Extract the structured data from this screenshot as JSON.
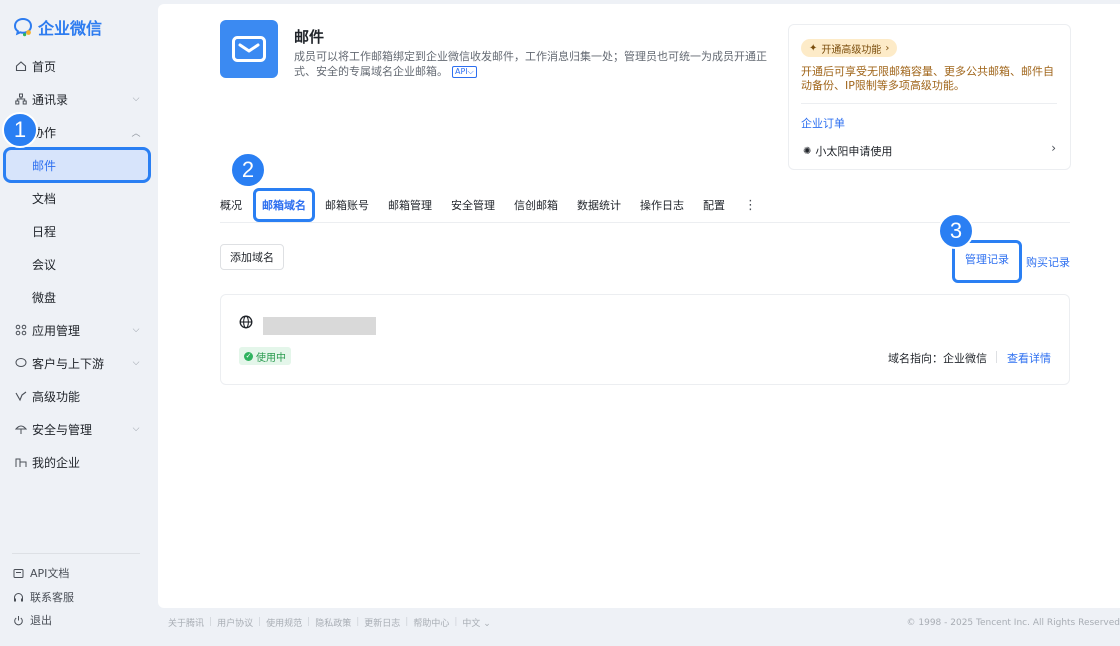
{
  "brand": {
    "name": "企业微信",
    "color": "#2d7cf0"
  },
  "sidebar": {
    "items": [
      {
        "label": "首页",
        "icon": "home-icon"
      },
      {
        "label": "通讯录",
        "icon": "org-tree-icon",
        "expandable": true
      },
      {
        "label": "协作",
        "icon": "collab-icon",
        "expandable": true,
        "expanded": true
      },
      {
        "label": "邮件",
        "sub": true,
        "active": true
      },
      {
        "label": "文档",
        "sub": true
      },
      {
        "label": "日程",
        "sub": true
      },
      {
        "label": "会议",
        "sub": true
      },
      {
        "label": "微盘",
        "sub": true
      },
      {
        "label": "应用管理",
        "icon": "grid-icon",
        "expandable": true
      },
      {
        "label": "客户与上下游",
        "icon": "chat-bubble-icon",
        "expandable": true
      },
      {
        "label": "高级功能",
        "icon": "sparkle-icon"
      },
      {
        "label": "安全与管理",
        "icon": "umbrella-icon",
        "expandable": true
      },
      {
        "label": "我的企业",
        "icon": "building-icon"
      }
    ],
    "bottom": [
      {
        "label": "API文档",
        "icon": "api-doc-icon"
      },
      {
        "label": "联系客服",
        "icon": "headset-icon"
      },
      {
        "label": "退出",
        "icon": "power-icon"
      }
    ]
  },
  "steps": [
    "1",
    "2",
    "3"
  ],
  "app": {
    "title": "邮件",
    "description": "成员可以将工作邮箱绑定到企业微信收发邮件，工作消息归集一处；管理员也可统一为成员开通正式、安全的专属域名企业邮箱。",
    "api_chip": "API"
  },
  "promo": {
    "badge": "开通高级功能",
    "text": "开通后可享受无限邮箱容量、更多公共邮箱、邮件自动备份、IP限制等多项高级功能。",
    "order_title": "企业订单",
    "sun_label": "小太阳申请使用"
  },
  "tabs": [
    "概况",
    "邮箱域名",
    "邮箱账号",
    "邮箱管理",
    "安全管理",
    "信创邮箱",
    "数据统计",
    "操作日志",
    "配置"
  ],
  "active_tab": "邮箱域名",
  "toolbar": {
    "add_domain": "添加域名",
    "manage_records": "管理记录",
    "buy_records": "购买记录"
  },
  "domain": {
    "status": "使用中",
    "pointing": "域名指向：企业微信",
    "detail": "查看详情"
  },
  "footer": {
    "links": [
      "关于腾讯",
      "用户协议",
      "使用规范",
      "隐私政策",
      "更新日志",
      "帮助中心",
      "中文"
    ],
    "copyright": "© 1998 - 2025 Tencent Inc. All Rights Reserved"
  }
}
